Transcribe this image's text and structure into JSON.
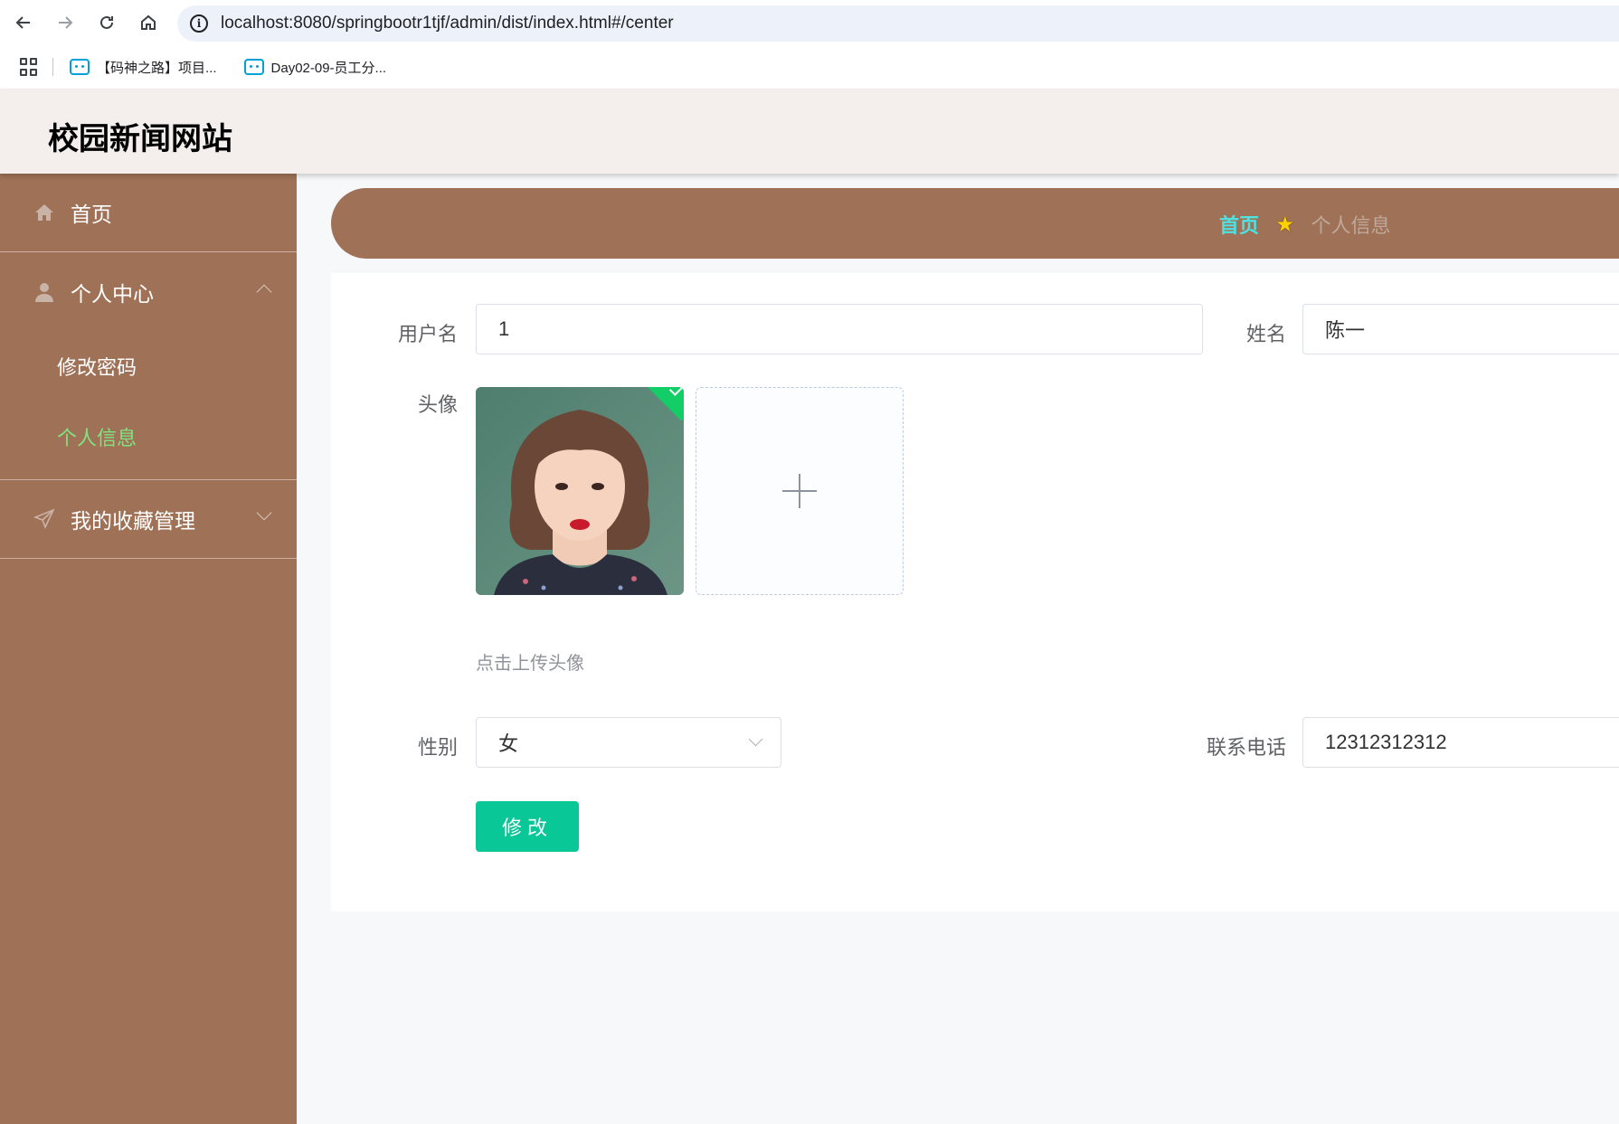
{
  "browser": {
    "url": "localhost:8080/springbootr1tjf/admin/dist/index.html#/center",
    "bookmarks": [
      {
        "label": "【码神之路】项目..."
      },
      {
        "label": "Day02-09-员工分..."
      }
    ]
  },
  "header": {
    "title": "校园新闻网站"
  },
  "sidebar": {
    "items": [
      {
        "label": "首页",
        "icon": "home-icon"
      },
      {
        "label": "个人中心",
        "icon": "user-icon",
        "expanded": true,
        "children": [
          {
            "label": "修改密码"
          },
          {
            "label": "个人信息",
            "active": true
          }
        ]
      },
      {
        "label": "我的收藏管理",
        "icon": "send-icon",
        "expanded": false
      }
    ]
  },
  "breadcrumb": {
    "home": "首页",
    "current": "个人信息"
  },
  "form": {
    "username_label": "用户名",
    "username_value": "1",
    "name_label": "姓名",
    "name_value": "陈一",
    "avatar_label": "头像",
    "avatar_hint": "点击上传头像",
    "gender_label": "性别",
    "gender_value": "女",
    "phone_label": "联系电话",
    "phone_value": "12312312312",
    "submit_label": "修改"
  },
  "colors": {
    "sidebar_bg": "#9f7157",
    "header_bg": "#f4eeed",
    "active_menu": "#7fe37f",
    "crumb_home": "#4fe0e0",
    "button": "#09c796"
  }
}
